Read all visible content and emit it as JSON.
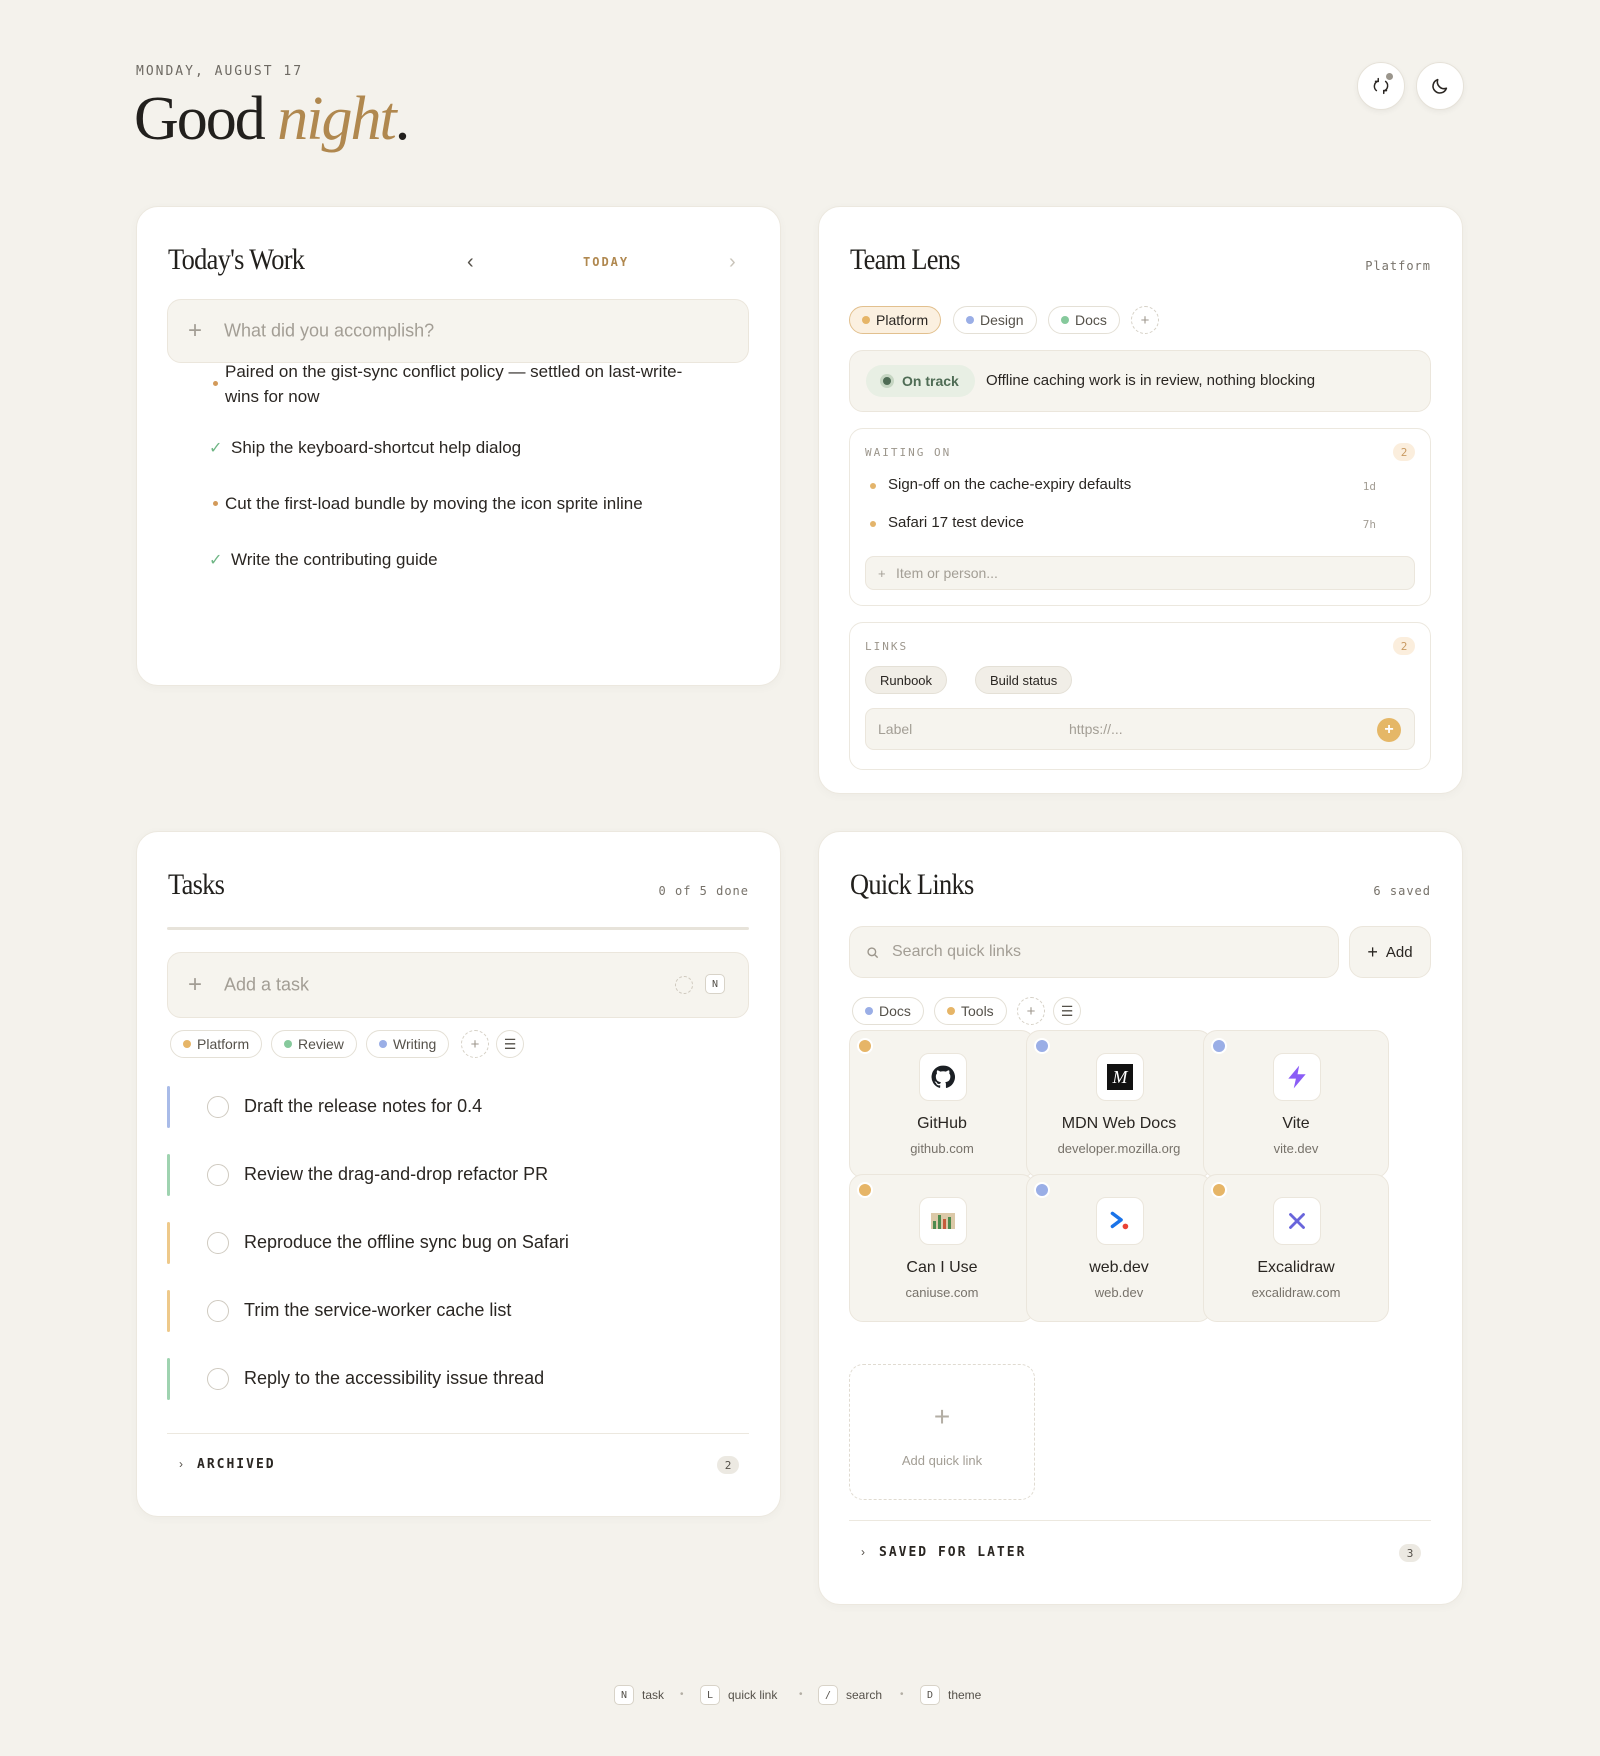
{
  "header": {
    "date": "MONDAY, AUGUST 17",
    "greeting_word": "Good",
    "greeting_time": "night",
    "greeting_punct": "."
  },
  "today_work": {
    "title": "Today's Work",
    "nav_label": "TODAY",
    "prev_icon": "chevron-left-icon",
    "next_icon": "chevron-right-icon",
    "input_placeholder": "What did you accomplish?",
    "items": [
      {
        "text": "Paired on the gist-sync conflict policy — settled on last-write-wins for now",
        "marker": "bullet"
      },
      {
        "text": "Ship the keyboard-shortcut help dialog",
        "marker": "check"
      },
      {
        "text": "Cut the first-load bundle by moving the icon sprite inline",
        "marker": "bullet"
      },
      {
        "text": "Write the contributing guide",
        "marker": "check"
      }
    ]
  },
  "team_lens": {
    "title": "Team Lens",
    "current_team": "Platform",
    "teams": [
      {
        "label": "Platform",
        "color": "#e6b567",
        "active": true
      },
      {
        "label": "Design",
        "color": "#9aaee6",
        "active": false
      },
      {
        "label": "Docs",
        "color": "#86c99c",
        "active": false
      }
    ],
    "status_label": "On track",
    "status_message": "Offline caching work is in review, nothing blocking",
    "waiting_on": {
      "label": "WAITING ON",
      "count": "2",
      "items": [
        {
          "text": "Sign-off on the cache-expiry defaults",
          "age": "1d"
        },
        {
          "text": "Safari 17 test device",
          "age": "7h"
        }
      ],
      "placeholder": "Item or person..."
    },
    "links": {
      "label": "LINKS",
      "count": "2",
      "items": [
        "Runbook",
        "Build status"
      ],
      "label_placeholder": "Label",
      "url_placeholder": "https://..."
    }
  },
  "tasks": {
    "title": "Tasks",
    "progress": "0 of 5 done",
    "progress_fraction": 0,
    "input_placeholder": "Add a task",
    "shortcut_key": "N",
    "tags": [
      {
        "label": "Platform",
        "color": "#e6b567"
      },
      {
        "label": "Review",
        "color": "#86c99c"
      },
      {
        "label": "Writing",
        "color": "#9aaee6"
      }
    ],
    "items": [
      {
        "text": "Draft the release notes for 0.4",
        "color": "#a9bbe8"
      },
      {
        "text": "Review the drag-and-drop refactor PR",
        "color": "#9fd3b0"
      },
      {
        "text": "Reproduce the offline sync bug on Safari",
        "color": "#eec98a"
      },
      {
        "text": "Trim the service-worker cache list",
        "color": "#eec98a"
      },
      {
        "text": "Reply to the accessibility issue thread",
        "color": "#9fd3b0"
      }
    ],
    "archived_label": "ARCHIVED",
    "archived_count": "2"
  },
  "quick_links": {
    "title": "Quick Links",
    "saved_count": "6 saved",
    "search_placeholder": "Search quick links",
    "add_label": "Add",
    "categories": [
      {
        "label": "Docs",
        "color": "#9aaee6"
      },
      {
        "label": "Tools",
        "color": "#e6b567"
      }
    ],
    "links": [
      {
        "name": "GitHub",
        "url": "github.com",
        "icon": "github-icon",
        "color": "#e6b567"
      },
      {
        "name": "MDN Web Docs",
        "url": "developer.mozilla.org",
        "icon": "mdn-icon",
        "color": "#9aaee6"
      },
      {
        "name": "Vite",
        "url": "vite.dev",
        "icon": "vite-icon",
        "color": "#9aaee6"
      },
      {
        "name": "Can I Use",
        "url": "caniuse.com",
        "icon": "caniuse-icon",
        "color": "#e6b567"
      },
      {
        "name": "web.dev",
        "url": "web.dev",
        "icon": "webdev-icon",
        "color": "#9aaee6"
      },
      {
        "name": "Excalidraw",
        "url": "excalidraw.com",
        "icon": "excalidraw-icon",
        "color": "#e6b567"
      }
    ],
    "add_tile_label": "Add quick link",
    "saved_for_later_label": "SAVED FOR LATER",
    "saved_for_later_count": "3"
  },
  "footer": {
    "shortcuts": [
      {
        "key": "N",
        "label": "task"
      },
      {
        "key": "L",
        "label": "quick link"
      },
      {
        "key": "/",
        "label": "search"
      },
      {
        "key": "D",
        "label": "theme"
      }
    ]
  }
}
